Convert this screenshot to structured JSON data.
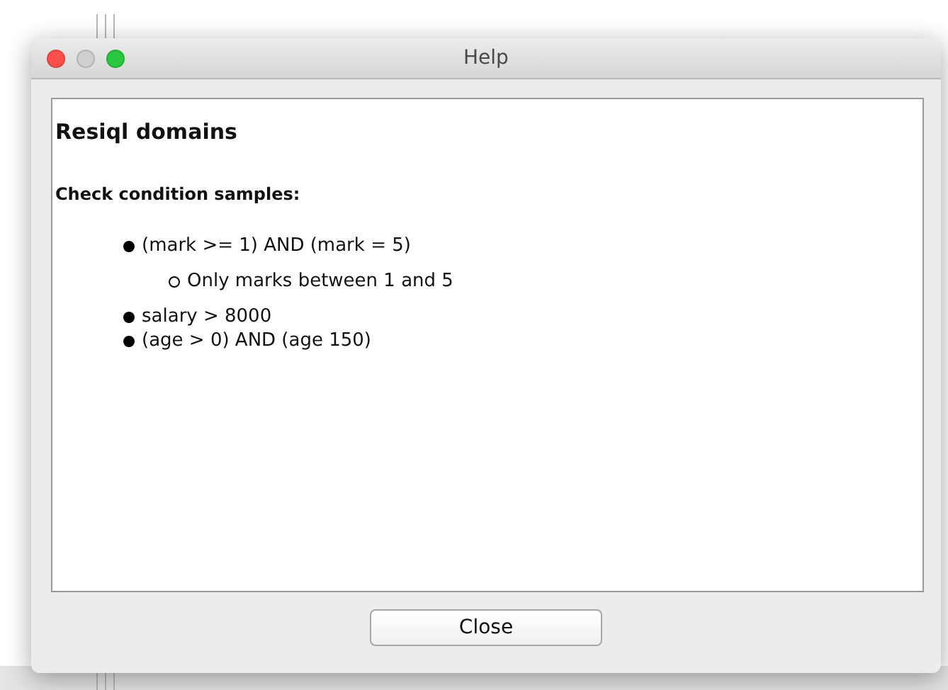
{
  "window": {
    "title": "Help",
    "controls": [
      {
        "kind": "close",
        "disabled": false
      },
      {
        "kind": "minimize",
        "disabled": true
      },
      {
        "kind": "zoom",
        "disabled": false
      }
    ]
  },
  "content": {
    "heading": "Resiql domains",
    "subheading": "Check condition samples:",
    "items": [
      {
        "text": "(mark >= 1) AND (mark = 5)",
        "children": [
          {
            "text": "Only marks between 1 and 5"
          }
        ]
      },
      {
        "text": "salary > 8000"
      },
      {
        "text": "(age > 0) AND (age 150)"
      }
    ]
  },
  "buttons": [
    {
      "label": "Close"
    }
  ]
}
